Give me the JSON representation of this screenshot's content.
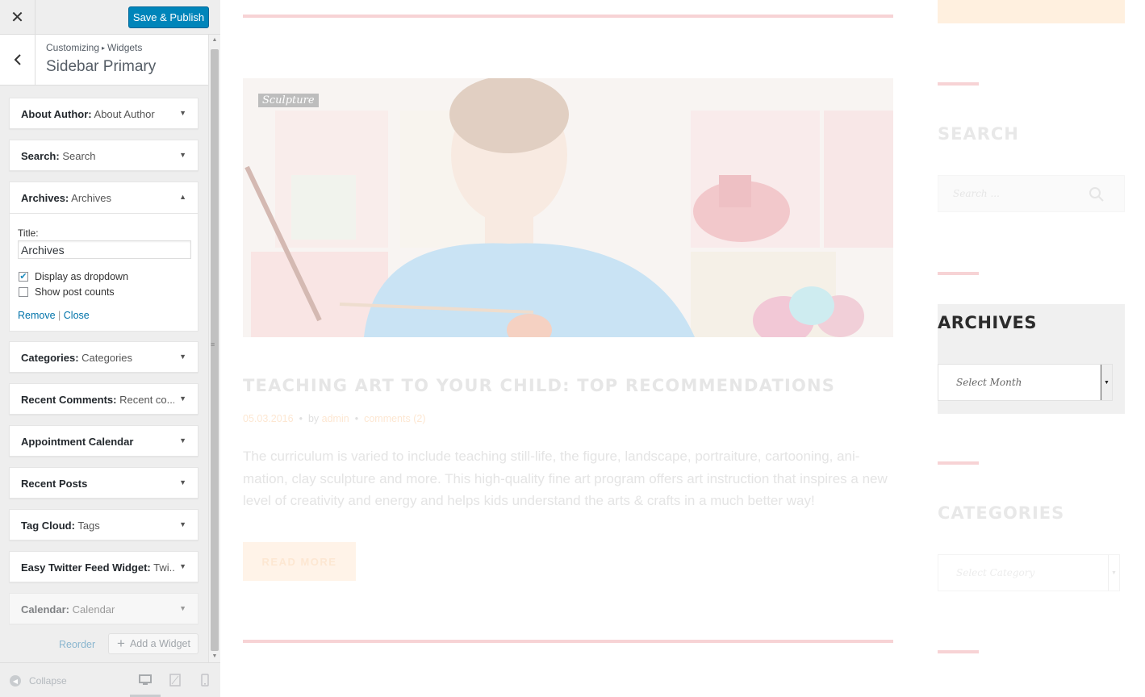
{
  "customizer": {
    "close_icon": "close-icon",
    "save_label": "Save & Publish",
    "breadcrumb": {
      "root": "Customizing",
      "child": "Widgets"
    },
    "section_title": "Sidebar Primary",
    "widgets": [
      {
        "name": "About Author",
        "sub": "About Author"
      },
      {
        "name": "Search",
        "sub": "Search"
      },
      {
        "name": "Archives",
        "sub": "Archives"
      },
      {
        "name": "Categories",
        "sub": "Categories"
      },
      {
        "name": "Recent Comments",
        "sub": "Recent co..."
      },
      {
        "name": "Appointment Calendar",
        "sub": ""
      },
      {
        "name": "Recent Posts",
        "sub": ""
      },
      {
        "name": "Tag Cloud",
        "sub": "Tags"
      },
      {
        "name": "Easy Twitter Feed Widget",
        "sub": "Twi..."
      },
      {
        "name": "Calendar",
        "sub": "Calendar"
      }
    ],
    "archives_form": {
      "title_label": "Title:",
      "title_value": "Archives",
      "dropdown_label": "Display as dropdown",
      "dropdown_checked": true,
      "counts_label": "Show post counts",
      "counts_checked": false,
      "remove_label": "Remove",
      "separator": "|",
      "close_label": "Close"
    },
    "reorder_label": "Reorder",
    "add_widget_label": "Add a Widget",
    "collapse_label": "Collapse",
    "accent_color": "#0085ba"
  },
  "preview": {
    "category_tag": "Sculpture",
    "post_title": "TEACHING ART TO YOUR CHILD: TOP RECOMMENDATIONS",
    "post_date": "05.03.2016",
    "post_by": "by",
    "post_author": "admin",
    "post_comments": "comments (2)",
    "post_body": "The curriculum is varied to include teaching still-life, the figure, landscape, portraiture, cartooning, ani-mation, clay sculpture and more. This high-quality fine art program offers art instruction that inspires a new level of creativity and energy and helps kids understand the arts & crafts in a much better way!",
    "read_more": "READ MORE",
    "sidebar": {
      "search_heading": "SEARCH",
      "search_placeholder": "Search ...",
      "archives_heading": "ARCHIVES",
      "archives_select": "Select Month",
      "categories_heading": "CATEGORIES",
      "categories_select": "Select Category"
    }
  }
}
